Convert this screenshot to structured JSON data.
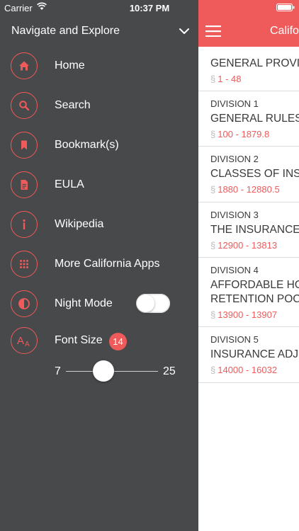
{
  "status_bar": {
    "carrier": "Carrier",
    "time": "10:37 PM"
  },
  "drawer": {
    "title": "Navigate and Explore",
    "items": [
      {
        "label": "Home",
        "icon": "home-icon"
      },
      {
        "label": "Search",
        "icon": "search-icon"
      },
      {
        "label": "Bookmark(s)",
        "icon": "bookmark-icon"
      },
      {
        "label": "EULA",
        "icon": "document-icon"
      },
      {
        "label": "Wikipedia",
        "icon": "info-icon"
      },
      {
        "label": "More California Apps",
        "icon": "grid-icon"
      },
      {
        "label": "Night Mode",
        "icon": "contrast-icon"
      },
      {
        "label": "Font Size",
        "icon": "font-size-icon"
      }
    ],
    "night_mode": false,
    "font_size": {
      "value": "14",
      "min": "7",
      "max": "25"
    }
  },
  "main": {
    "title": "Califo",
    "rows": [
      {
        "division": "",
        "title": "GENERAL PROVIS",
        "range": "1 - 48"
      },
      {
        "division": "DIVISION 1",
        "title": "GENERAL RULES",
        "range": "100 - 1879.8"
      },
      {
        "division": "DIVISION 2",
        "title": "CLASSES OF INS",
        "range": "1880 - 12880.5"
      },
      {
        "division": "DIVISION 3",
        "title": "THE INSURANCE",
        "range": "12900 - 13813"
      },
      {
        "division": "DIVISION 4",
        "title": "AFFORDABLE HO",
        "title2": "RETENTION POC",
        "range": "13900 - 13907"
      },
      {
        "division": "DIVISION 5",
        "title": "INSURANCE ADJ",
        "range": "14000 - 16032"
      }
    ]
  },
  "colors": {
    "accent": "#ef5a5a",
    "drawer_bg": "#47494b"
  }
}
